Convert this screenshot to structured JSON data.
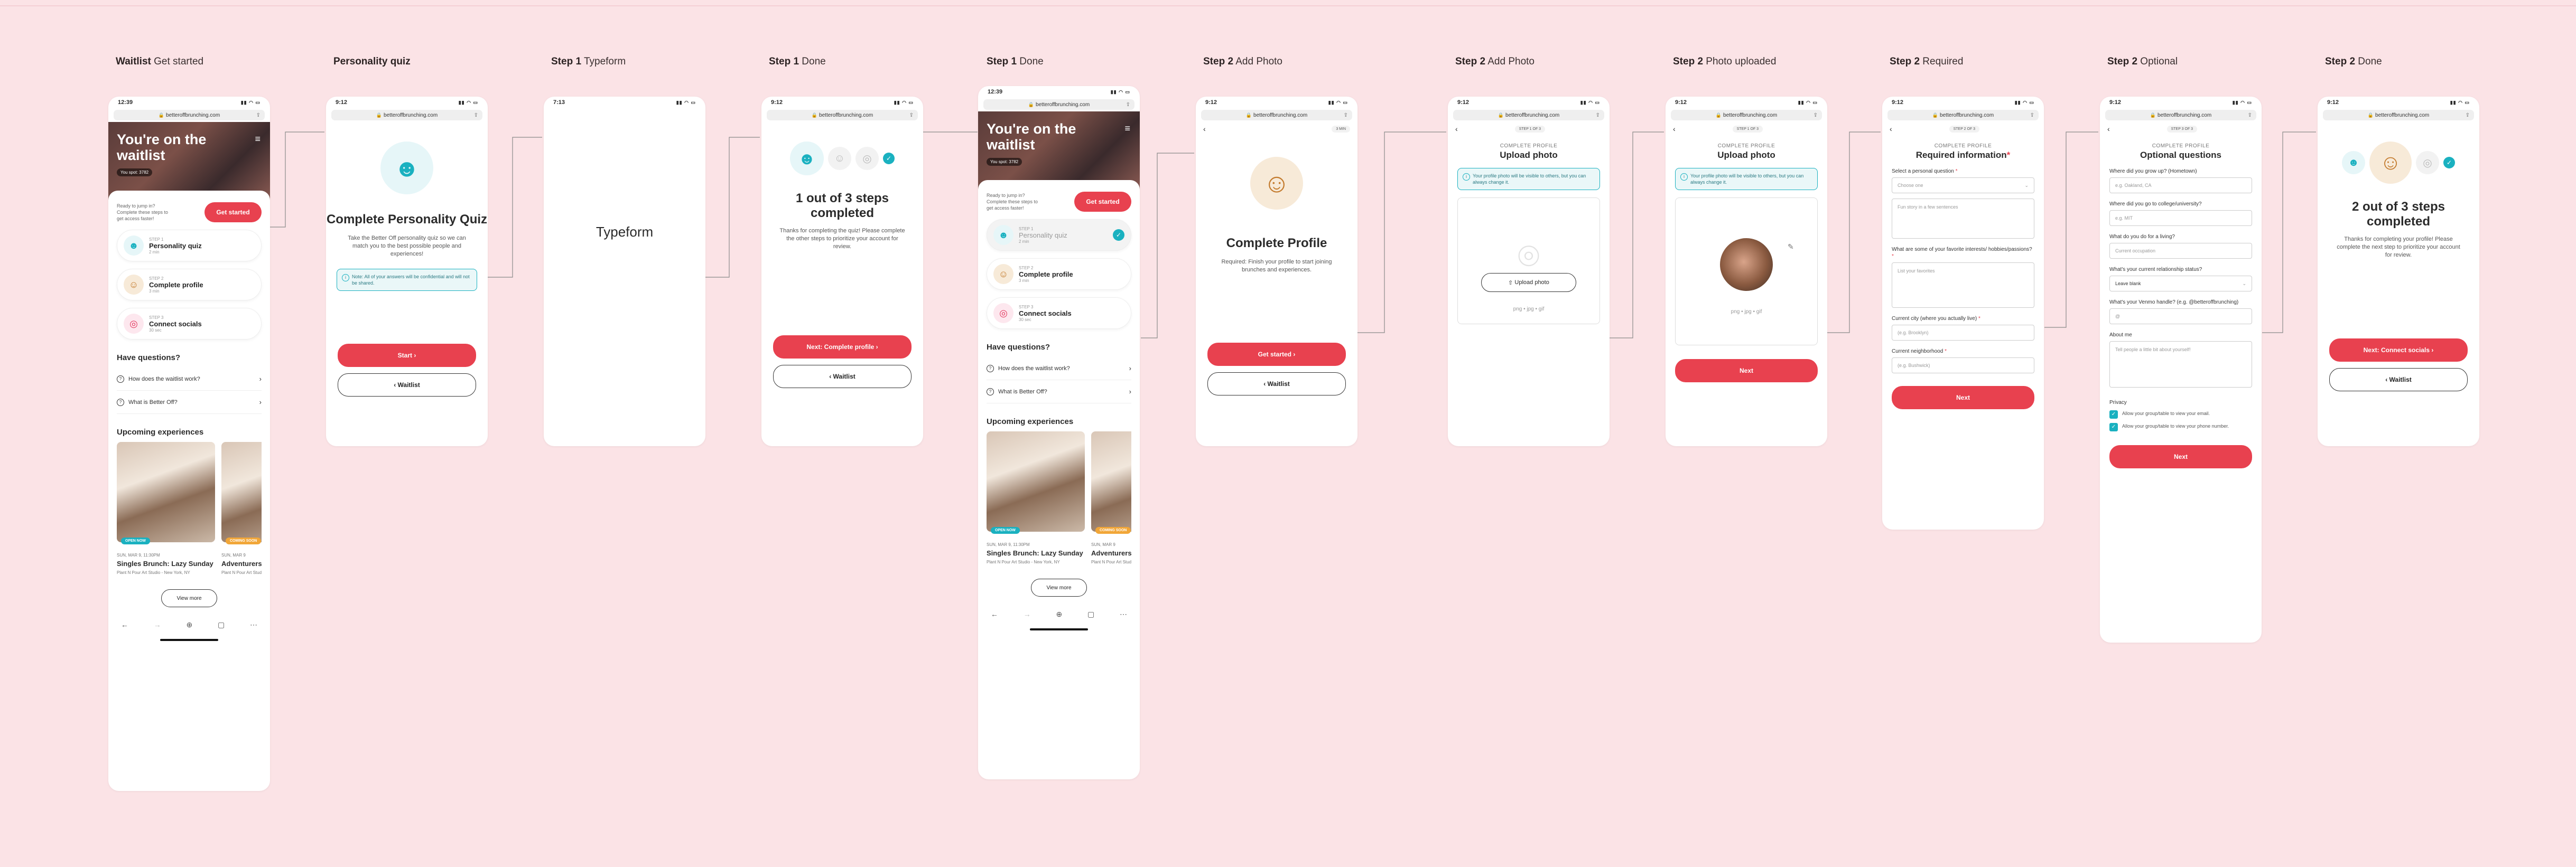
{
  "screens": [
    {
      "title_bold": "Waitlist",
      "title_rest": " Get started"
    },
    {
      "title_bold": "Personality quiz",
      "title_rest": ""
    },
    {
      "title_bold": "Step 1",
      "title_rest": " Typeform"
    },
    {
      "title_bold": "Step 1",
      "title_rest": " Done"
    },
    {
      "title_bold": "Step 1",
      "title_rest": " Done"
    },
    {
      "title_bold": "Step 2",
      "title_rest": " Add Photo"
    },
    {
      "title_bold": "Step 2",
      "title_rest": " Add Photo"
    },
    {
      "title_bold": "Step 2",
      "title_rest": " Photo uploaded"
    },
    {
      "title_bold": "Step 2",
      "title_rest": " Required"
    },
    {
      "title_bold": "Step 2",
      "title_rest": " Optional"
    },
    {
      "title_bold": "Step 2",
      "title_rest": " Done"
    }
  ],
  "status": {
    "time1": "12:39",
    "time2": "9:12",
    "time3": "7:13",
    "icons": "▮▮ ◠ ▭"
  },
  "url": "betteroffbrunching.com",
  "waitlist": {
    "hero_title": "You're on the waitlist",
    "hero_badge": "You spot: 3782",
    "question": "Ready to jump in? Complete these steps to get access faster!",
    "get_started": "Get started",
    "steps": [
      {
        "label": "STEP 1",
        "title": "Personality quiz",
        "dur": "2 min",
        "icon": "head-icon"
      },
      {
        "label": "STEP 2",
        "title": "Complete profile",
        "dur": "3 min",
        "icon": "person-icon"
      },
      {
        "label": "STEP 3",
        "title": "Connect socials",
        "dur": "30 sec",
        "icon": "instagram-icon"
      }
    ],
    "have_questions": "Have questions?",
    "faqs": [
      "How does the waitlist work?",
      "What is Better Off?"
    ],
    "upcoming": "Upcoming experiences",
    "experiences": [
      {
        "tag": "OPEN NOW",
        "date": "SUN, MAR 9, 11:30PM",
        "title": "Singles Brunch: Lazy Sunday",
        "loc": "Plant N Pour Art Studio - New York, NY"
      },
      {
        "tag": "COMING SOON",
        "date": "SUN, MAR 9",
        "title": "Adventurers Meetup",
        "loc": "Plant N Pour Art Studio - New York, NY"
      }
    ],
    "view_more": "View more"
  },
  "quiz": {
    "title": "Complete Personality Quiz",
    "desc": "Take the Better Off personality quiz so we can match you to the best possible people and experiences!",
    "note": "Note: All of your answers will be confidential and will not be shared.",
    "start": "Start",
    "waitlist": "Waitlist"
  },
  "typeform": {
    "title": "Typeform"
  },
  "done1": {
    "title": "1 out of 3 steps completed",
    "desc": "Thanks for completing the quiz! Please complete the other steps to prioritize your account for review.",
    "next": "Next: Complete profile",
    "waitlist": "Waitlist"
  },
  "add_photo_intro": {
    "pill": "3 MIN",
    "title": "Complete Profile",
    "desc": "Required: Finish your profile to start joining brunches and experiences.",
    "get_started": "Get started",
    "waitlist": "Waitlist"
  },
  "upload": {
    "pill": "STEP 1 OF 3",
    "kicker": "COMPLETE PROFILE",
    "title": "Upload photo",
    "note": "Your profile photo will be visible to others, but you can always change it.",
    "upload_btn": "Upload photo",
    "formats": "png • jpg • gif",
    "next": "Next"
  },
  "required": {
    "pill": "STEP 2 OF 3",
    "kicker": "COMPLETE PROFILE",
    "title": "Required information",
    "q1": "Select a personal question",
    "q1_ph": "Choose one",
    "q1_ta": "Fun story in a few sentences",
    "q2": "What are some of your favorite interests/ hobbies/passions?",
    "q2_ph": "List your favorites",
    "q3": "Current city (where you actually live)",
    "q3_ph": "(e.g. Brooklyn)",
    "q4": "Current neighborhood",
    "q4_ph": "(e.g. Bushwick)",
    "next": "Next"
  },
  "optional": {
    "pill": "STEP 3 OF 3",
    "kicker": "COMPLETE PROFILE",
    "title": "Optional questions",
    "q1": "Where did you grow up? (Hometown)",
    "q1_ph": "e.g. Oakland, CA",
    "q2": "Where did you go to college/university?",
    "q2_ph": "e.g. MIT",
    "q3": "What do you do for a living?",
    "q3_ph": "Current occupation",
    "q4": "What's your current relationship status?",
    "q4_ph": "Leave blank",
    "q5": "What's your Venmo handle? (e.g. @betteroffbrunching)",
    "q5_ph": "@",
    "q6": "About me",
    "q6_ph": "Tell people a little bit about yourself!",
    "privacy": "Privacy",
    "cb1": "Allow your group/table to view your email.",
    "cb2": "Allow your group/table to view your phone number.",
    "next": "Next"
  },
  "done2": {
    "title": "2 out of 3 steps completed",
    "desc": "Thanks for completing your profile! Please complete the next step to prioritize your account for review.",
    "next": "Next: Connect socials",
    "waitlist": "Waitlist"
  },
  "colors": {
    "accent": "#e8414f",
    "teal": "#1ab1c0",
    "bg": "#fbe3e6"
  }
}
